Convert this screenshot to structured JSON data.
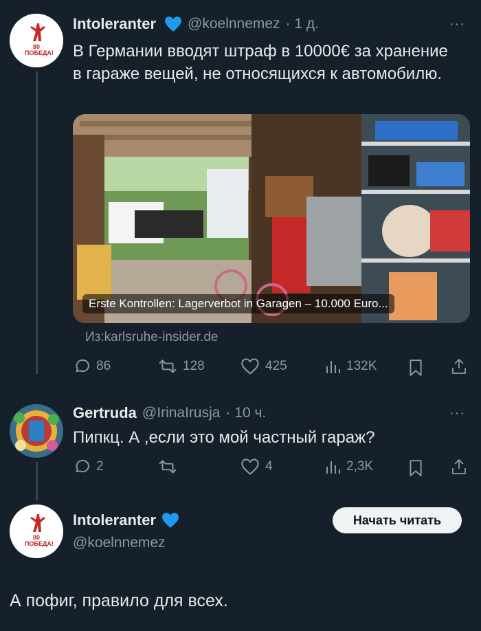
{
  "colors": {
    "background": "#15202b",
    "text": "#e7e9ea",
    "muted": "#8b98a5",
    "verified_heart": "#1d9bf0",
    "follow_button_bg": "#eff3f4"
  },
  "tweet1": {
    "name": "Intoleranter",
    "handle": "@koelnnemez",
    "time": "· 1 д.",
    "more": "···",
    "text": "В Германии вводят штраф в 10000€ за хранение в гараже вещей, не относящихся к автомобилю.",
    "avatar_badge": "80 ПОБЕДА!",
    "card_caption": "Erste Kontrollen: Lagerverbot in Garagen – 10.000 Euro...",
    "card_source": "Из:karlsruhe-insider.de",
    "actions": {
      "replies": "86",
      "retweets": "128",
      "likes": "425",
      "views": "132K"
    }
  },
  "tweet2": {
    "name": "Gertruda",
    "handle": "@IrinaIrusja",
    "time": "· 10 ч.",
    "more": "···",
    "text": "Пипкц. А ,если это мой частный гараж?",
    "actions": {
      "replies": "2",
      "retweets": "",
      "likes": "4",
      "views": "2,3K"
    }
  },
  "tweet3": {
    "name": "Intoleranter",
    "handle": "@koelnnemez",
    "follow_label": "Начать читать",
    "avatar_badge": "80 ПОБЕДА!",
    "text": "А пофиг, правило для всех."
  }
}
